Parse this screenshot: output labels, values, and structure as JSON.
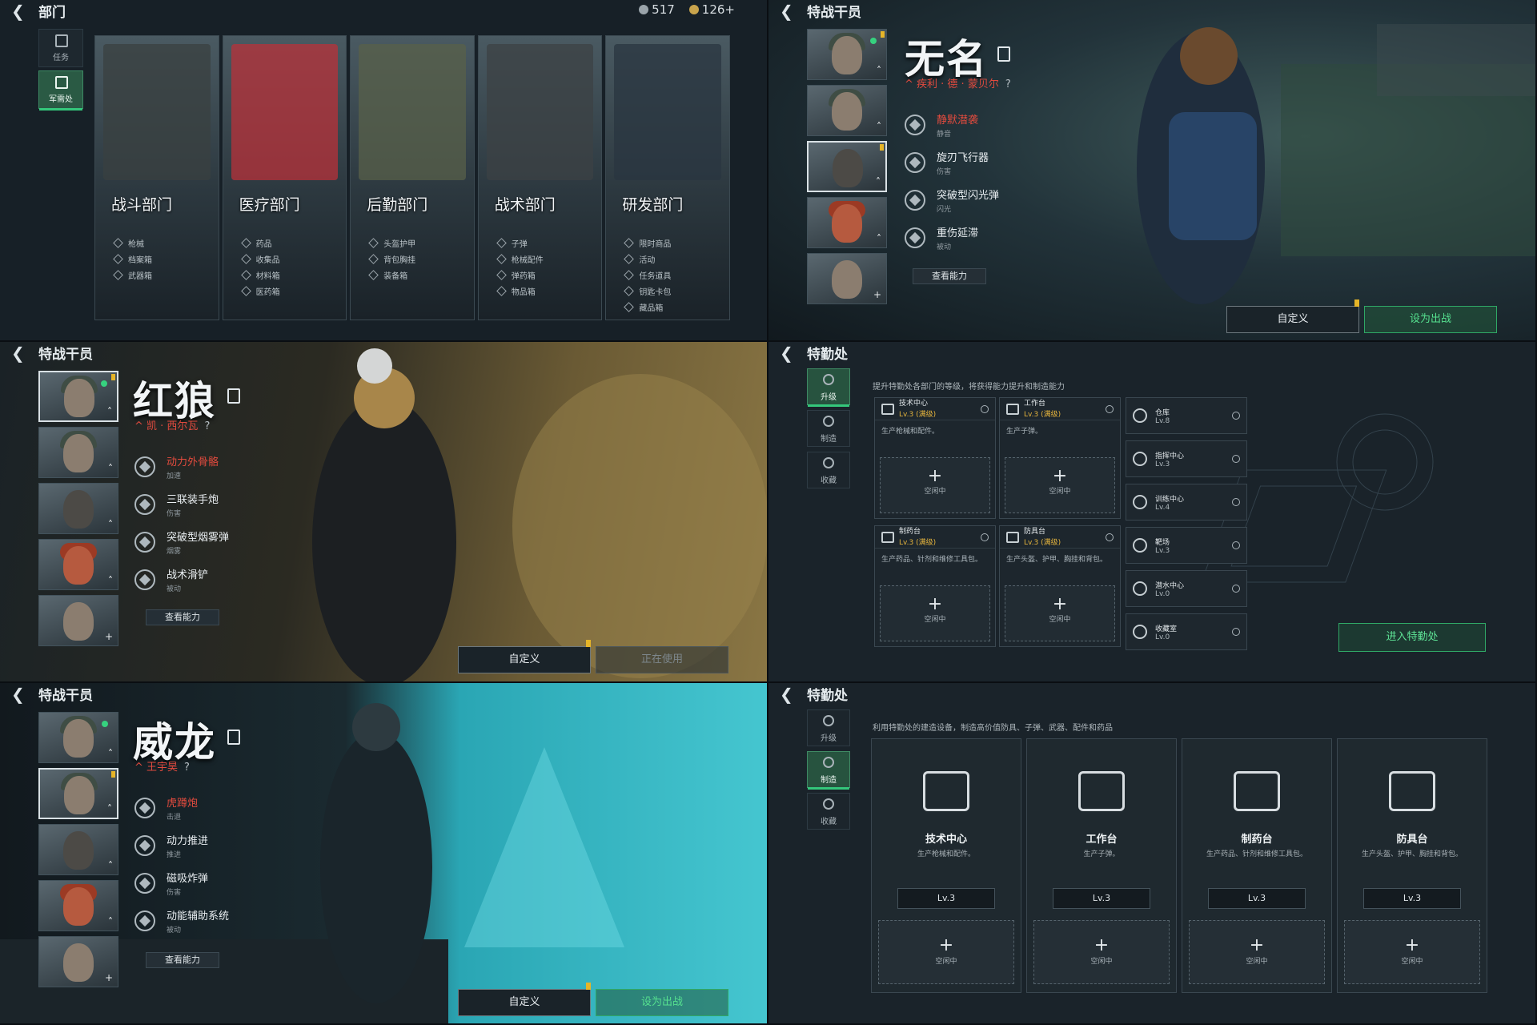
{
  "panel1": {
    "title": "部门",
    "resources": [
      {
        "value": "517",
        "icon": "silver-coin-icon"
      },
      {
        "value": "126+",
        "icon": "gold-coin-icon"
      }
    ],
    "tabs": [
      {
        "label": "任务",
        "active": false
      },
      {
        "label": "军需处",
        "active": true
      }
    ],
    "departments": [
      {
        "name": "战斗部门",
        "items": [
          "枪械",
          "档案箱",
          "武器箱"
        ],
        "art_color": "#3a4040"
      },
      {
        "name": "医疗部门",
        "items": [
          "药品",
          "收集品",
          "材料箱",
          "医药箱"
        ],
        "art_color": "#b8323a"
      },
      {
        "name": "后勤部门",
        "items": [
          "头盔护甲",
          "背包胸挂",
          "装备箱"
        ],
        "art_color": "#58604a"
      },
      {
        "name": "战术部门",
        "items": [
          "子弹",
          "枪械配件",
          "弹药箱",
          "物品箱"
        ],
        "art_color": "#3c4244"
      },
      {
        "name": "研发部门",
        "items": [
          "限时商品",
          "活动",
          "任务道具",
          "钥匙卡包",
          "藏品箱"
        ],
        "art_color": "#2a3640"
      }
    ]
  },
  "panel2": {
    "title": "特战干员",
    "name": "无名",
    "class_line": "疾利 · 德 · 蒙贝尔",
    "skills": [
      {
        "name": "静默潜袭",
        "sub": "静音",
        "highlight": true
      },
      {
        "name": "旋刃飞行器",
        "sub": "伤害",
        "highlight": false
      },
      {
        "name": "突破型闪光弹",
        "sub": "闪光",
        "highlight": false
      },
      {
        "name": "重伤延滞",
        "sub": "被动",
        "highlight": false
      }
    ],
    "view_label": "查看能力",
    "custom_label": "自定义",
    "deploy_label": "设为出战"
  },
  "panel3": {
    "title": "特战干员",
    "name": "红狼",
    "class_line": "凯 · 西尔瓦",
    "skills": [
      {
        "name": "动力外骨骼",
        "sub": "加速",
        "highlight": true
      },
      {
        "name": "三联装手炮",
        "sub": "伤害",
        "highlight": false
      },
      {
        "name": "突破型烟雾弹",
        "sub": "烟雾",
        "highlight": false
      },
      {
        "name": "战术滑铲",
        "sub": "被动",
        "highlight": false
      }
    ],
    "view_label": "查看能力",
    "custom_label": "自定义",
    "inuse_label": "正在使用"
  },
  "panel4": {
    "title": "特勤处",
    "tabs": [
      {
        "label": "升级",
        "active": true
      },
      {
        "label": "制造",
        "active": false
      },
      {
        "label": "收藏",
        "active": false
      }
    ],
    "desc": "提升特勤处各部门的等级，将获得能力提升和制造能力",
    "facilities": [
      {
        "name": "技术中心",
        "level": "Lv.3 (满级)",
        "desc": "生产枪械和配件。",
        "slot": "空闲中"
      },
      {
        "name": "工作台",
        "level": "Lv.3 (满级)",
        "desc": "生产子弹。",
        "slot": "空闲中"
      },
      {
        "name": "制药台",
        "level": "Lv.3 (满级)",
        "desc": "生产药品、针剂和维修工具包。",
        "slot": "空闲中"
      },
      {
        "name": "防具台",
        "level": "Lv.3 (满级)",
        "desc": "生产头盔、护甲、胸挂和背包。",
        "slot": "空闲中"
      }
    ],
    "small_facilities": [
      {
        "name": "仓库",
        "level": "Lv.8"
      },
      {
        "name": "指挥中心",
        "level": "Lv.3"
      },
      {
        "name": "训练中心",
        "level": "Lv.4"
      },
      {
        "name": "靶场",
        "level": "Lv.3"
      },
      {
        "name": "潜水中心",
        "level": "Lv.0"
      },
      {
        "name": "收藏室",
        "level": "Lv.0"
      }
    ],
    "enter_label": "进入特勤处"
  },
  "panel5": {
    "title": "特战干员",
    "name": "威龙",
    "class_line": "王宇昊",
    "skills": [
      {
        "name": "虎蹲炮",
        "sub": "击退",
        "highlight": true
      },
      {
        "name": "动力推进",
        "sub": "推进",
        "highlight": false
      },
      {
        "name": "磁吸炸弹",
        "sub": "伤害",
        "highlight": false
      },
      {
        "name": "动能辅助系统",
        "sub": "被动",
        "highlight": false
      }
    ],
    "view_label": "查看能力",
    "custom_label": "自定义",
    "deploy_label": "设为出战"
  },
  "panel6": {
    "title": "特勤处",
    "tabs": [
      {
        "label": "升级",
        "active": false
      },
      {
        "label": "制造",
        "active": true
      },
      {
        "label": "收藏",
        "active": false
      }
    ],
    "desc": "利用特勤处的建造设备，制造高价值防具、子弹、武器、配件和药品",
    "cards": [
      {
        "name": "技术中心",
        "desc": "生产枪械和配件。",
        "level": "Lv.3",
        "slot": "空闲中"
      },
      {
        "name": "工作台",
        "desc": "生产子弹。",
        "level": "Lv.3",
        "slot": "空闲中"
      },
      {
        "name": "制药台",
        "desc": "生产药品、针剂和维修工具包。",
        "level": "Lv.3",
        "slot": "空闲中"
      },
      {
        "name": "防具台",
        "desc": "生产头盔、护甲、胸挂和背包。",
        "level": "Lv.3",
        "slot": "空闲中"
      }
    ]
  }
}
